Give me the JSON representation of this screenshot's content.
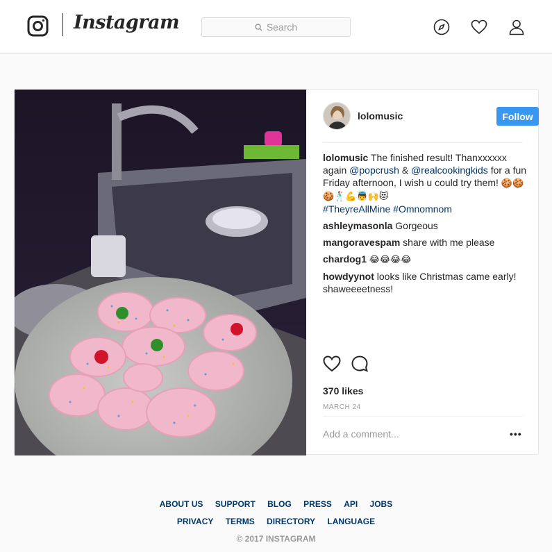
{
  "header": {
    "wordmark": "Instagram",
    "search_placeholder": "Search",
    "icons": [
      "instagram-logo-icon",
      "search-icon",
      "compass-icon",
      "heart-icon",
      "profile-icon"
    ]
  },
  "post": {
    "author": "lolomusic",
    "follow_label": "Follow",
    "caption": {
      "user": "lolomusic",
      "text_1": " The finished result! Thanxxxxxx again ",
      "mention_1": "@popcrush",
      "text_2": " & ",
      "mention_2": "@realcookingkids",
      "text_3": " for a fun Friday afternoon, I wish u could try them! ",
      "emojis": "🍪🍪🍪🕺💪👼🙌😻",
      "hashtag_1": "#TheyreAllMine",
      "hashtag_2": "#Omnomnom"
    },
    "comments": [
      {
        "user": "ashleymasonla",
        "text": " Gorgeous"
      },
      {
        "user": "mangoravespam",
        "text": " share with me please"
      },
      {
        "user": "chardog1",
        "text": " 😂😂😂😂"
      },
      {
        "user": "howdyynot",
        "text": " looks like Christmas came early! shaweeeetness!"
      }
    ],
    "likes": "370 likes",
    "date": "MARCH 24",
    "add_comment_placeholder": "Add a comment...",
    "more_label": "•••"
  },
  "footer": {
    "links_row1": [
      "ABOUT US",
      "SUPPORT",
      "BLOG",
      "PRESS",
      "API",
      "JOBS"
    ],
    "links_row2": [
      "PRIVACY",
      "TERMS",
      "DIRECTORY",
      "LANGUAGE"
    ],
    "copyright": "© 2017 INSTAGRAM"
  },
  "colors": {
    "accent": "#3897f0",
    "link": "#003569",
    "muted": "#999999",
    "border": "#dbdbdb"
  }
}
